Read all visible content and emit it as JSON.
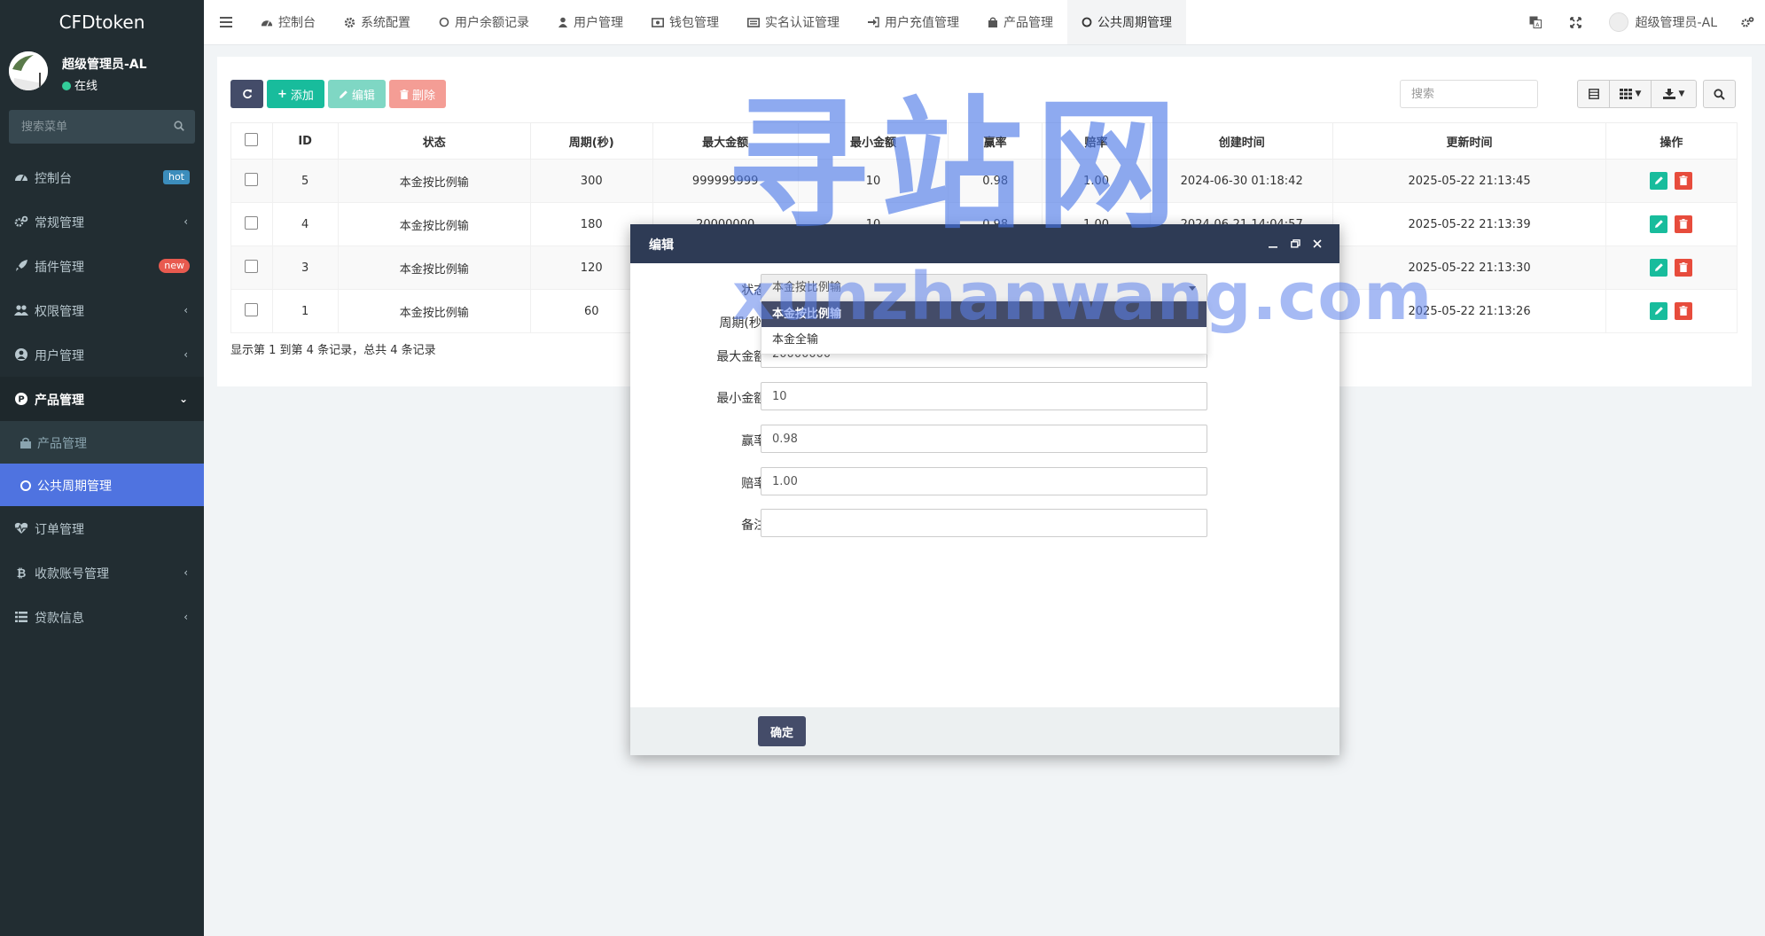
{
  "app": {
    "title": "CFDtoken"
  },
  "sidebar": {
    "user": {
      "name": "超级管理员-AL",
      "status": "在线"
    },
    "search_placeholder": "搜索菜单",
    "items": [
      {
        "label": "控制台",
        "badge": "hot"
      },
      {
        "label": "常规管理"
      },
      {
        "label": "插件管理",
        "badge": "new"
      },
      {
        "label": "权限管理"
      },
      {
        "label": "用户管理"
      },
      {
        "label": "产品管理"
      },
      {
        "label": "订单管理"
      },
      {
        "label": "收款账号管理"
      },
      {
        "label": "贷款信息"
      }
    ],
    "submenu": [
      {
        "label": "产品管理"
      },
      {
        "label": "公共周期管理"
      }
    ]
  },
  "topnav": {
    "tabs": [
      {
        "label": "控制台"
      },
      {
        "label": "系统配置"
      },
      {
        "label": "用户余额记录"
      },
      {
        "label": "用户管理"
      },
      {
        "label": "钱包管理"
      },
      {
        "label": "实名认证管理"
      },
      {
        "label": "用户充值管理"
      },
      {
        "label": "产品管理"
      },
      {
        "label": "公共周期管理"
      }
    ],
    "user_label": "超级管理员-AL"
  },
  "toolbar": {
    "add": "添加",
    "edit": "编辑",
    "delete": "删除",
    "search_placeholder": "搜索"
  },
  "table": {
    "columns": [
      "ID",
      "状态",
      "周期(秒)",
      "最大金额",
      "最小金额",
      "赢率",
      "赔率",
      "创建时间",
      "更新时间",
      "操作"
    ],
    "rows": [
      {
        "id": "5",
        "status": "本金按比例输",
        "period": "300",
        "max": "999999999",
        "min": "10",
        "win": "0.98",
        "odds": "1.00",
        "created": "2024-06-30 01:18:42",
        "updated": "2025-05-22 21:13:45"
      },
      {
        "id": "4",
        "status": "本金按比例输",
        "period": "180",
        "max": "20000000",
        "min": "10",
        "win": "0.98",
        "odds": "1.00",
        "created": "2024-06-21 14:04:57",
        "updated": "2025-05-22 21:13:39"
      },
      {
        "id": "3",
        "status": "本金按比例输",
        "period": "120",
        "max": "",
        "min": "",
        "win": "",
        "odds": "",
        "created": "",
        "updated": "2025-05-22 21:13:30"
      },
      {
        "id": "1",
        "status": "本金按比例输",
        "period": "60",
        "max": "",
        "min": "",
        "win": "",
        "odds": "",
        "created": "",
        "updated": "2025-05-22 21:13:26"
      }
    ],
    "pagination": "显示第 1 到第 4 条记录，总共 4 条记录"
  },
  "watermark": {
    "title": "寻站网",
    "url": "xunzhanwang.com"
  },
  "modal": {
    "title": "编辑",
    "fields": {
      "status_label": "状态:",
      "status_value": "本金按比例输",
      "period_label": "周期(秒):",
      "max_label": "最大金额:",
      "max_value": "20000000",
      "min_label": "最小金额:",
      "min_value": "10",
      "win_label": "赢率:",
      "win_value": "0.98",
      "odds_label": "赔率:",
      "odds_value": "1.00",
      "remark_label": "备注:",
      "remark_value": ""
    },
    "options": [
      "本金按比例输",
      "本金全输"
    ],
    "ok": "确定"
  },
  "colors": {
    "sidebar_bg": "#222d32",
    "active_item": "#4f73e0",
    "header_dark": "#2e3b55",
    "success": "#18bc9c",
    "danger": "#e74c3c"
  }
}
